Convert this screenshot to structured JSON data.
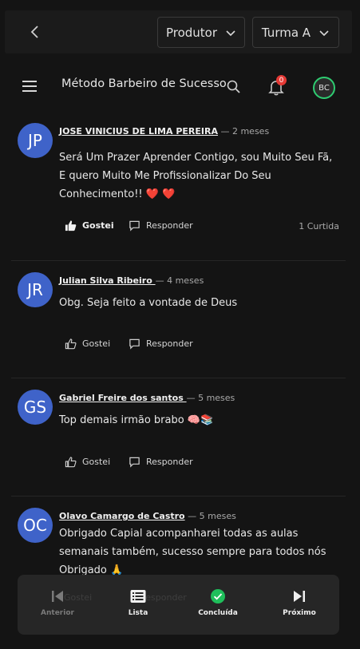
{
  "topbar": {
    "producer_label": "Produtor",
    "class_label": "Turma A"
  },
  "header": {
    "title": "Método Barbeiro de Sucesso",
    "notification_count": "0",
    "user_initials": "BC"
  },
  "comments": [
    {
      "initials": "JP",
      "author": "JOSE VINICIUS DE LIMA PEREIRA",
      "time": " — 2 meses",
      "text": "Será Um Prazer Aprender Contigo, sou Muito Seu Fã, E quero Muito Me Profissionalizar Do Seu Conhecimento!! ❤️ ❤️",
      "like_label": "Gostei",
      "reply_label": "Responder",
      "likes_count": "1 Curtida"
    },
    {
      "initials": "JR",
      "author": "Julian Silva Ribeiro ",
      "time": " — 4 meses",
      "text": "Obg. Seja feito a vontade de Deus",
      "like_label": "Gostei",
      "reply_label": "Responder"
    },
    {
      "initials": "GS",
      "author": "Gabriel Freire dos santos ",
      "time": " — 5 meses",
      "text": "Top demais irmão brabo 🧠📚",
      "like_label": "Gostei",
      "reply_label": "Responder"
    },
    {
      "initials": "OC",
      "author": "Olavo Camargo de Castro",
      "time": " — 5 meses",
      "text": "Obrigado Capial  acompanharei todas as aulas semanais também,   sucesso sempre para todos nós Obrigado 🙏",
      "like_label": "Gostei",
      "reply_label": "Responder"
    }
  ],
  "bottom_nav": {
    "prev_label": "Anterior",
    "list_label": "Lista",
    "done_label": "Concluída",
    "next_label": "Próximo"
  },
  "colors": {
    "avatar_bg": "#3f63c9",
    "done_green": "#1fbf5b",
    "badge_red": "#e53935"
  }
}
